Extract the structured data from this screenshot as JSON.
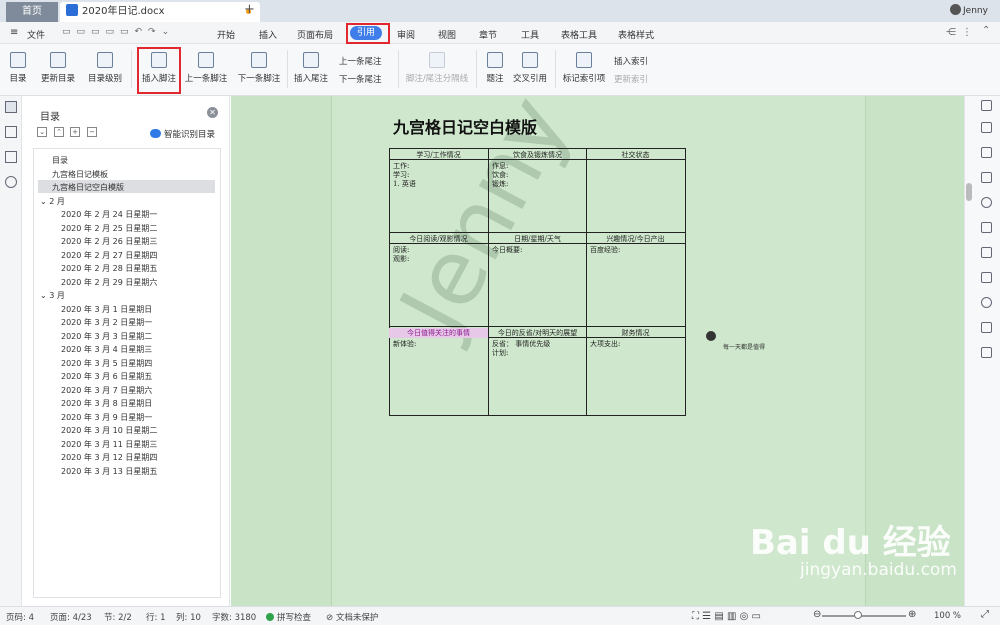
{
  "titlebar": {
    "home_tab": "首页",
    "doc_tab": "2020年日记.docx",
    "add": "+",
    "user": "Jenny"
  },
  "menubar": {
    "file": "文件",
    "items": [
      "开始",
      "插入",
      "页面布局",
      "引用",
      "审阅",
      "视图",
      "章节",
      "工具",
      "表格工具",
      "表格样式"
    ],
    "active": "引用"
  },
  "ribbon": {
    "toc": "目录",
    "update_toc": "更新目录",
    "toc_level": "目录级别",
    "insert_footnote": "插入脚注",
    "prev_footnote": "上一条脚注",
    "next_footnote": "下一条脚注",
    "insert_endnote": "插入尾注",
    "prev_endnote": "上一条尾注",
    "next_endnote": "下一条尾注",
    "separator": "脚注/尾注分隔线",
    "caption": "题注",
    "crossref": "交叉引用",
    "mark_index": "标记索引项",
    "insert_index": "插入索引",
    "update_index": "更新索引"
  },
  "nav": {
    "title": "目录",
    "smart": "智能识别目录",
    "toc": [
      "目录",
      "九宫格日记模板",
      "九宫格日记空白模版",
      "2 月",
      "2020 年 2 月 24 日星期一",
      "2020 年 2 月 25 日星期二",
      "2020 年 2 月 26 日星期三",
      "2020 年 2 月 27 日星期四",
      "2020 年 2 月 28 日星期五",
      "2020 年 2 月 29 日星期六",
      "3 月",
      "2020 年 3 月 1 日星期日",
      "2020 年 3 月 2 日星期一",
      "2020 年 3 月 3 日星期二",
      "2020 年 3 月 4 日星期三",
      "2020 年 3 月 5 日星期四",
      "2020 年 3 月 6 日星期五",
      "2020 年 3 月 7 日星期六",
      "2020 年 3 月 8 日星期日",
      "2020 年 3 月 9 日星期一",
      "2020 年 3 月 10 日星期二",
      "2020 年 3 月 11 日星期三",
      "2020 年 3 月 12 日星期四",
      "2020 年 3 月 13 日星期五"
    ]
  },
  "doc": {
    "title": "九宫格日记空白模版",
    "headers": [
      "学习/工作情况",
      "饮食及锻炼情况",
      "社交状态",
      "今日阅读/观影情况",
      "日期/星期/天气",
      "兴趣情况/今日产出",
      "今日值得关注的事情",
      "今日的反省/对明天的展望",
      "财务情况"
    ],
    "cells": [
      "工作:\n学习:\n1. 英语",
      "作息:\n饮食:\n锻炼:",
      "",
      "阅读:\n观影:",
      "今日概要:",
      "百度经验:",
      "新体验:",
      "反省： 事情优先级\n计划:",
      "大项支出:"
    ],
    "watermark": "Jenny",
    "comment": "每一天都是值得"
  },
  "status": {
    "page_num": "页码: 4",
    "pages": "页面: 4/23",
    "section": "节: 2/2",
    "row": "行: 1",
    "col": "列: 10",
    "words": "字数: 3180",
    "spell": "拼写检查",
    "protect": "文档未保护",
    "zoom": "100 %"
  },
  "watermark_site": {
    "brand": "Bai du 经验",
    "url": "jingyan.baidu.com"
  }
}
